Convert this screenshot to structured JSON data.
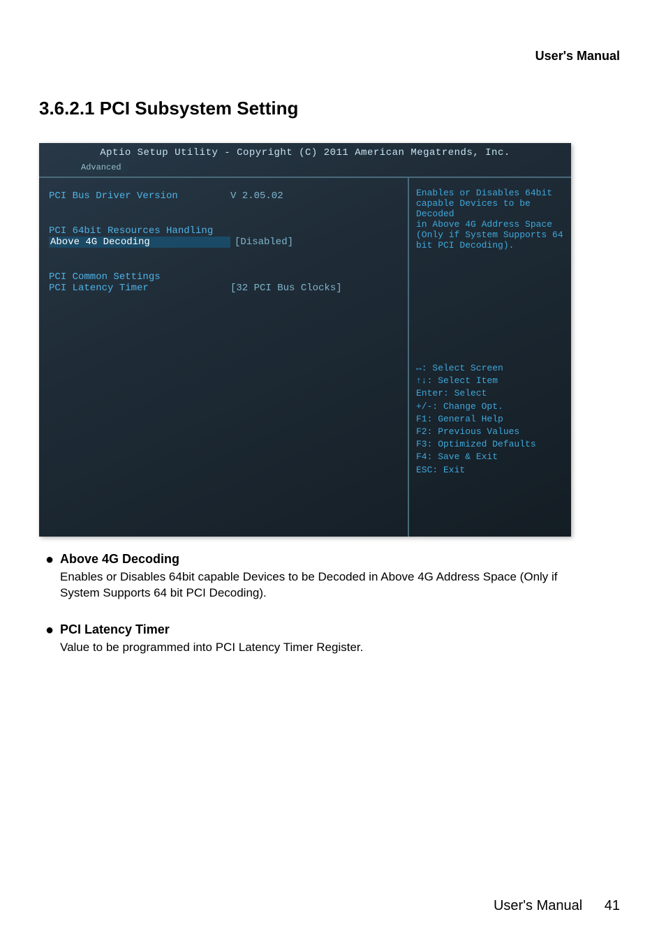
{
  "header": {
    "right": "User's  Manual"
  },
  "section": {
    "number": "3.6.2.1  PCI Subsystem Setting"
  },
  "bios": {
    "title": "Aptio Setup Utility - Copyright (C) 2011 American Megatrends, Inc.",
    "tab": "Advanced",
    "left": {
      "row0_label": "PCI Bus Driver Version",
      "row0_value": "V 2.05.02",
      "row1_label": "PCI 64bit Resources Handling",
      "row2_label": "Above 4G Decoding",
      "row2_value": "[Disabled]",
      "row3_label": "PCI Common Settings",
      "row4_label": "PCI Latency Timer",
      "row4_value": "[32 PCI Bus Clocks]"
    },
    "right": {
      "desc1": "Enables or Disables 64bit",
      "desc2": "capable Devices to be Decoded",
      "desc3": "in Above 4G Address Space",
      "desc4": "(Only if System Supports 64",
      "desc5": "bit PCI Decoding).",
      "help1": "↔: Select Screen",
      "help2": "↑↓: Select Item",
      "help3": "Enter: Select",
      "help4": "+/-: Change Opt.",
      "help5": "F1: General Help",
      "help6": "F2: Previous Values",
      "help7": "F3: Optimized Defaults",
      "help8": "F4: Save & Exit",
      "help9": "ESC: Exit"
    }
  },
  "bullets": {
    "b0_head": "Above 4G Decoding",
    "b0_desc": "Enables or Disables 64bit capable Devices to be Decoded in Above 4G Address Space (Only if System Supports 64 bit PCI Decoding).",
    "b1_head": "PCI Latency Timer",
    "b1_desc": "Value to be programmed into PCI Latency Timer Register."
  },
  "footer": {
    "label": "User's  Manual",
    "page": "41"
  }
}
